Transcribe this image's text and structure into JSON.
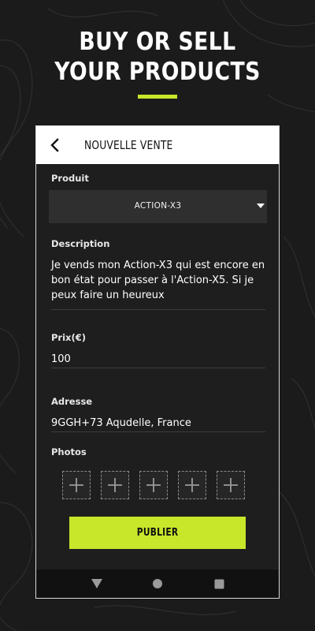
{
  "hero": {
    "line1": "BUY OR SELL",
    "line2": "YOUR PRODUCTS"
  },
  "colors": {
    "accent": "#c8e62a",
    "background": "#1b1b1b",
    "card": "#1e1e1e",
    "appbar": "#ffffff"
  },
  "appbar": {
    "title": "NOUVELLE VENTE",
    "back_icon": "chevron-left-icon"
  },
  "form": {
    "product": {
      "label": "Produit",
      "selected": "ACTION-X3"
    },
    "description": {
      "label": "Description",
      "value": "Je vends mon Action-X3 qui est encore en bon état pour passer à l'Action-X5. Si je peux faire un heureux"
    },
    "price": {
      "label": "Prix(€)",
      "value": "100"
    },
    "address": {
      "label": "Adresse",
      "value": "9GGH+73 Aqudelle, France"
    },
    "photos": {
      "label": "Photos",
      "slot_icon": "plus-icon",
      "slot_count": 5
    },
    "submit_label": "PUBLIER"
  },
  "navbar": {
    "back_icon": "triangle-back-icon",
    "home_icon": "circle-home-icon",
    "recents_icon": "square-recents-icon"
  }
}
